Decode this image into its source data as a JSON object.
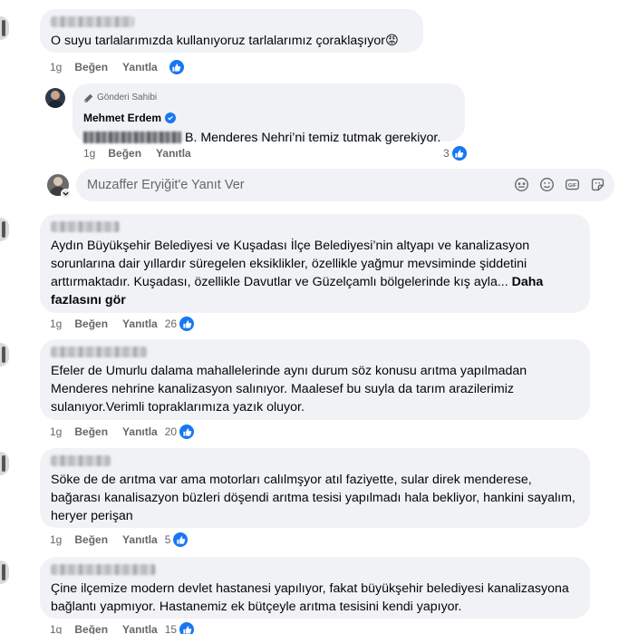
{
  "actions": {
    "like": "Beğen",
    "reply": "Yanıtla"
  },
  "comments": [
    {
      "time": "1g",
      "text": "O suyu tarlalarımızda kullanıyoruz tarlalarımız çoraklaşıyor😡",
      "likes": ""
    },
    {
      "time": "1g",
      "text": "Aydın Büyükşehir Belediyesi ve Kuşadası İlçe Belediyesi’nin altyapı ve kanalizasyon sorunlarına dair yıllardır süregelen eksiklikler, özellikle yağmur mevsiminde şiddetini arttırmaktadır. Kuşadası, özellikle Davutlar ve Güzelçamlı bölgelerinde kış ayla...",
      "see_more": "Daha fazlasını gör",
      "likes": "26"
    },
    {
      "time": "1g",
      "text": "Efeler de Umurlu dalama mahallelerinde aynı durum söz konusu arıtma yapılmadan Menderes nehrine kanalizasyon salınıyor. Maalesef bu suyla da tarım arazilerimiz sulanıyor.Verimli topraklarımıza yazık oluyor.",
      "likes": "20"
    },
    {
      "time": "1g",
      "text": "Söke de de arıtma var ama motorları calılmşyor atıl faziyette, sular direk menderese, bağarası kanalisazyon büzleri döşendi arıtma tesisi yapılmadı hala bekliyor, hankini sayalım, heryer perişan",
      "likes": "5"
    },
    {
      "time": "1g",
      "text": "Çine ilçemize modern devlet hastanesi yapılıyor, fakat büyükşehir belediyesi kanalizasyona bağlantı yapmıyor. Hastanemiz ek bütçeyle arıtma tesisini kendi yapıyor.",
      "likes": "15"
    }
  ],
  "reply": {
    "badge": "Gönderi Sahibi",
    "author": "Mehmet Erdem",
    "text": "B. Menderes Nehri’ni temiz tutmak gerekiyor.",
    "time": "1g",
    "likes": "3"
  },
  "reply_input": {
    "placeholder": "Muzaffer Eryiğit'e Yanıt Ver"
  },
  "colors": {
    "bubble": "#f0f2f5",
    "like_blue": "#1877f2",
    "meta": "#65676b"
  }
}
